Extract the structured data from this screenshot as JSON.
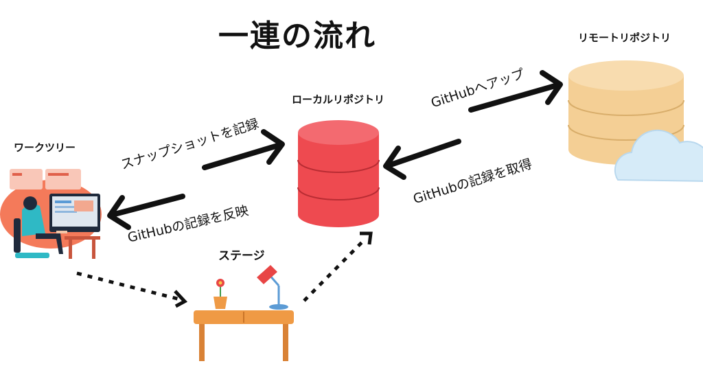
{
  "title": "一連の流れ",
  "nodes": {
    "work_tree": "ワークツリー",
    "stage": "ステージ",
    "local_repo": "ローカルリポジトリ",
    "remote_repo": "リモートリポジトリ"
  },
  "edges": {
    "snapshot": "スナップショットを記録",
    "reflect": "GitHubの記録を反映",
    "push": "GitHubへアップ",
    "fetch": "GitHubの記録を取得"
  },
  "colors": {
    "local_db": "#f0484f",
    "remote_db": "#f4cf95",
    "cloud": "#cfe8f8",
    "table": "#ef9a45",
    "lamp": "#e84545",
    "person_bg": "#f47a5a"
  },
  "icons": [
    "database-icon",
    "cloud-icon",
    "desk-icon",
    "lamp-icon",
    "flower-pot-icon",
    "person-at-computer-icon"
  ]
}
